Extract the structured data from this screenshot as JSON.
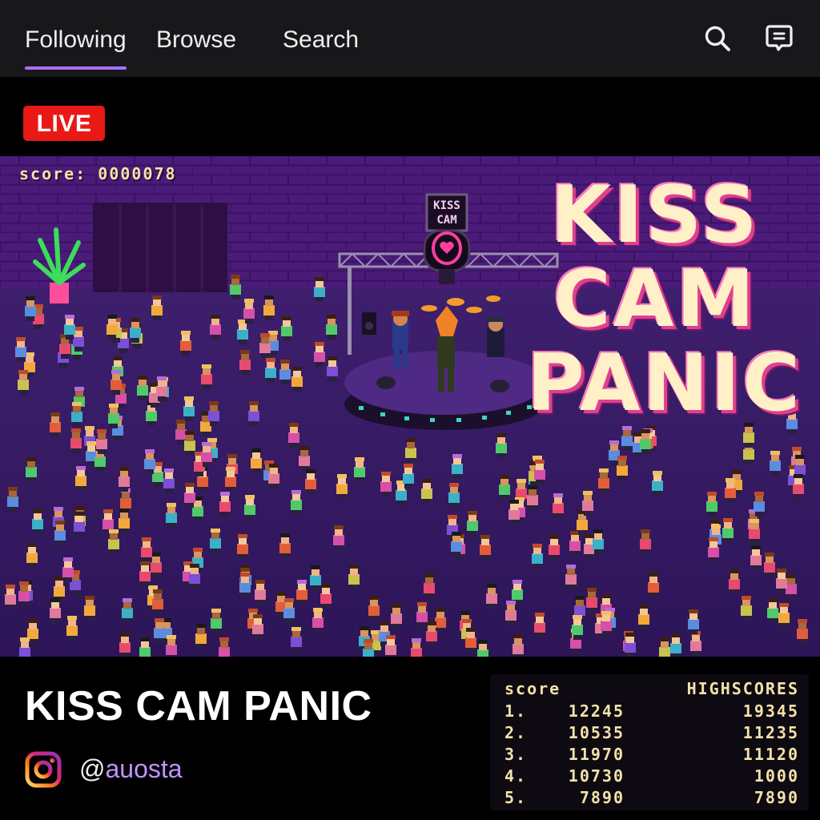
{
  "nav": {
    "tabs": [
      {
        "label": "Following",
        "active": true
      },
      {
        "label": "Browse",
        "active": false
      },
      {
        "label": "Search",
        "active": false
      }
    ],
    "icons": [
      "search-icon",
      "chat-icon"
    ],
    "accent": "#a970ff"
  },
  "live": {
    "label": "LIVE",
    "color": "#e91916"
  },
  "video": {
    "score_label": "score: 0000078",
    "title_lines": [
      "KISS",
      "CAM",
      "PANIC"
    ],
    "booth_sign": [
      "KISS",
      "CAM"
    ]
  },
  "stream": {
    "title": "KISS CAM PANIC",
    "social_icon": "instagram-icon",
    "handle_prefix": "@",
    "handle_name": "auosta"
  },
  "highscores": {
    "left_header": "score",
    "right_header": "HIGHSCORES",
    "rows": [
      {
        "rank": "1.",
        "score": "12245",
        "high": "19345"
      },
      {
        "rank": "2.",
        "score": "10535",
        "high": "11235"
      },
      {
        "rank": "3.",
        "score": "11970",
        "high": "11120"
      },
      {
        "rank": "4.",
        "score": "10730",
        "high": "1000"
      },
      {
        "rank": "5.",
        "score": "7890",
        "high": "7890"
      }
    ]
  }
}
